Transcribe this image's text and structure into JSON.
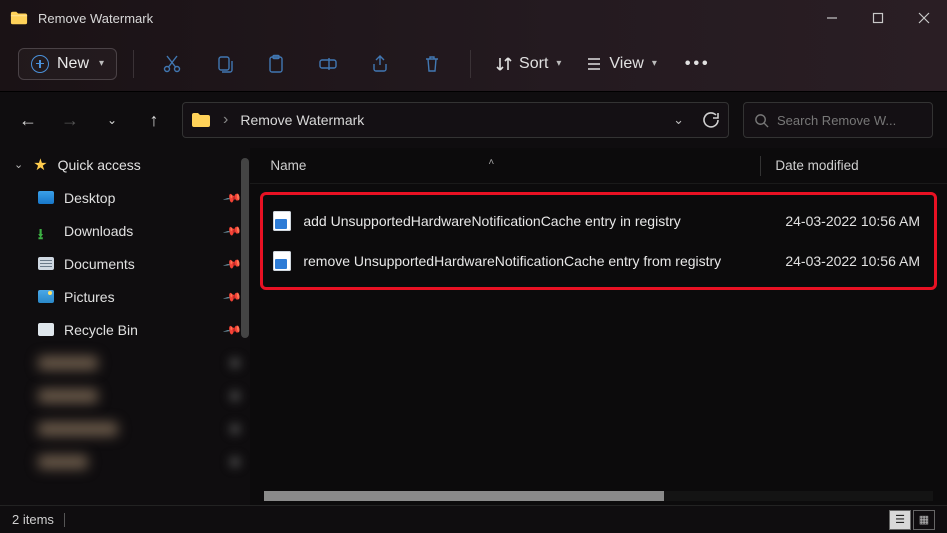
{
  "window": {
    "title": "Remove Watermark"
  },
  "toolbar": {
    "new_label": "New",
    "sort_label": "Sort",
    "view_label": "View"
  },
  "breadcrumb": {
    "current": "Remove Watermark"
  },
  "search": {
    "placeholder": "Search Remove W..."
  },
  "sidebar": {
    "section": "Quick access",
    "items": [
      {
        "label": "Desktop"
      },
      {
        "label": "Downloads"
      },
      {
        "label": "Documents"
      },
      {
        "label": "Pictures"
      },
      {
        "label": "Recycle Bin"
      }
    ]
  },
  "columns": {
    "name": "Name",
    "date": "Date modified"
  },
  "files": [
    {
      "name": "add UnsupportedHardwareNotificationCache entry in registry",
      "date": "24-03-2022 10:56 AM"
    },
    {
      "name": "remove UnsupportedHardwareNotificationCache entry from registry",
      "date": "24-03-2022 10:56 AM"
    }
  ],
  "status": {
    "count": "2 items"
  }
}
